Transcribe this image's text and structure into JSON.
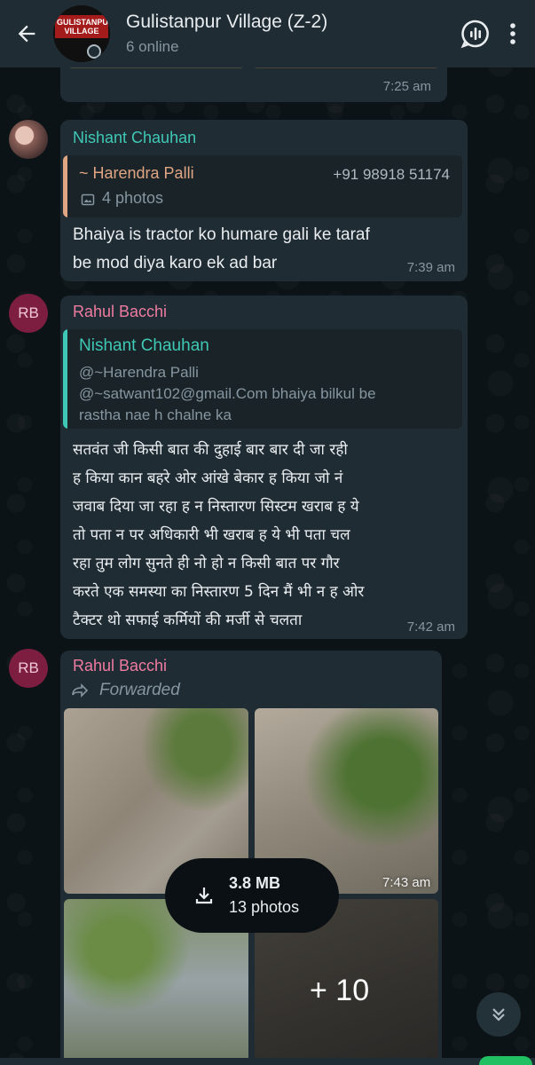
{
  "header": {
    "title": "Gulistanpur Village (Z-2)",
    "subtitle": "6 online",
    "avatar_text": "GULISTANPUR VILLAGE",
    "icons": [
      "back-arrow-icon",
      "voice-chat-icon",
      "more-vert-icon"
    ]
  },
  "messages": [
    {
      "time": "7:25 am"
    },
    {
      "sender": "Nishant Chauhan",
      "sender_color": "#3fc8b5",
      "quote": {
        "name": "~ Harendra Palli",
        "phone": "+91 98918 51174",
        "body": "4 photos",
        "bar_color": "#e0a583"
      },
      "text_lines": [
        "Bhaiya is tractor ko humare gali ke taraf",
        "be mod diya karo ek ad bar"
      ],
      "time": "7:39 am"
    },
    {
      "sender": "Rahul Bacchi",
      "sender_color": "#f07ba0",
      "avatar_initials": "RB",
      "quote": {
        "name": "Nishant Chauhan",
        "lines": [
          "@~Harendra Palli",
          "@~satwant102@gmail.Com bhaiya bilkul be",
          "rastha nae h chalne ka"
        ],
        "bar_color": "#3fc8b5"
      },
      "text_lines": [
        "सतवंत जी किसी बात की दुहाई बार बार दी जा रही",
        "ह किया कान बहरे ओर आंखे बेकार ह किया जो नं",
        "जवाब दिया जा रहा ह न निस्तारण सिस्टम खराब ह ये",
        "तो पता न पर अधिकारी भी खराब ह ये भी पता चल",
        "रहा तुम लोग सुनते ही नो हो न किसी बात पर गौर",
        "करते एक समस्या का निस्तारण 5 दिन मैं भी न ह ओर",
        "टैक्टर थो सफाई कर्मियों की मर्जी से चलता"
      ],
      "time": "7:42 am"
    },
    {
      "sender": "Rahul Bacchi",
      "sender_color": "#f07ba0",
      "avatar_initials": "RB",
      "forwarded": "Forwarded",
      "download": {
        "size": "3.8 MB",
        "count": "13 photos"
      },
      "more_count": "+ 10",
      "time": "7:43 am"
    }
  ]
}
